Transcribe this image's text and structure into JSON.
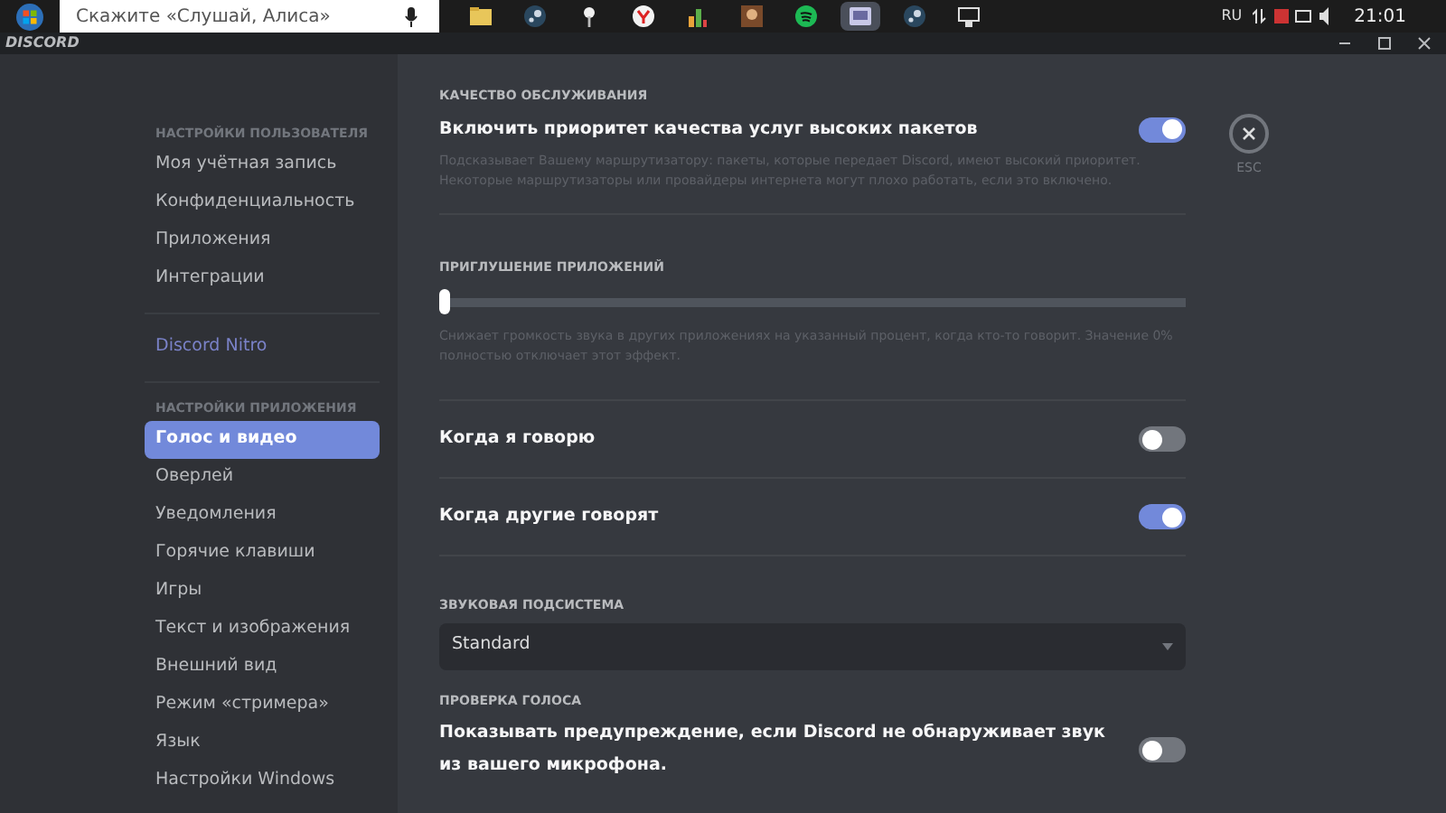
{
  "taskbar": {
    "search": {
      "placeholder": "Скажите «Слушай, Алиса»"
    },
    "apps": [
      {
        "kind": "folder"
      },
      {
        "kind": "steam"
      },
      {
        "kind": "pin"
      },
      {
        "kind": "browser"
      },
      {
        "kind": "chart"
      },
      {
        "kind": "game"
      },
      {
        "kind": "music"
      },
      {
        "kind": "chat",
        "selected": true
      },
      {
        "kind": "steam"
      },
      {
        "kind": "monitor"
      }
    ],
    "language": "RU",
    "time": "21:01"
  },
  "window": {
    "title": "DISCORD"
  },
  "sidebar": {
    "groups": [
      {
        "header": "НАСТРОЙКИ ПОЛЬЗОВАТЕЛЯ",
        "items": [
          {
            "label": "Моя учётная запись",
            "selected": false
          },
          {
            "label": "Конфиденциальность",
            "selected": false
          },
          {
            "label": "Приложения",
            "selected": false
          },
          {
            "label": "Интеграции",
            "selected": false
          }
        ]
      },
      {
        "items": [
          {
            "label": "Discord Nitro",
            "selected": false,
            "color": "#7a82c8"
          }
        ]
      },
      {
        "header": "НАСТРОЙКИ ПРИЛОЖЕНИЯ",
        "items": [
          {
            "label": "Голос и видео",
            "selected": true
          },
          {
            "label": "Оверлей",
            "selected": false
          },
          {
            "label": "Уведомления",
            "selected": false
          },
          {
            "label": "Горячие клавиши",
            "selected": false
          },
          {
            "label": "Игры",
            "selected": false
          },
          {
            "label": "Текст и изображения",
            "selected": false
          },
          {
            "label": "Внешний вид",
            "selected": false
          },
          {
            "label": "Режим «стримера»",
            "selected": false
          },
          {
            "label": "Язык",
            "selected": false
          },
          {
            "label": "Настройки Windows",
            "selected": false
          }
        ]
      }
    ]
  },
  "sections": [
    {
      "kind": "toggle",
      "header": "КАЧЕСТВО ОБСЛУЖИВАНИЯ",
      "label": "Включить приоритет качества услуг высоких пакетов",
      "description": "Подсказывает Вашему маршрутизатору: пакеты, которые передает Discord, имеют высокий приоритет. Некоторые маршрутизаторы или провайдеры интернета могут плохо работать, если это включено.",
      "on": true,
      "divider": true
    },
    {
      "kind": "slider",
      "header": "ПРИГЛУШЕНИЕ ПРИЛОЖЕНИЙ",
      "description": "Снижает громкость звука в других приложениях на указанный процент, когда кто-то говорит. Значение 0% полностью отключает этот эффект.",
      "level": 0,
      "divider": true
    },
    {
      "kind": "toggle",
      "label": "Когда я говорю",
      "on": false,
      "divider": true
    },
    {
      "kind": "toggle",
      "label": "Когда другие говорят",
      "on": true,
      "divider": true
    },
    {
      "kind": "select",
      "header": "ЗВУКОВАЯ ПОДСИСТЕМА",
      "value": "Standard"
    },
    {
      "kind": "toggle",
      "header": "ПРОВЕРКА ГОЛОСА",
      "label": "Показывать предупреждение, если Discord не обнаруживает звук из вашего микрофона.",
      "on": false
    }
  ],
  "close": {
    "label": "ESC"
  }
}
